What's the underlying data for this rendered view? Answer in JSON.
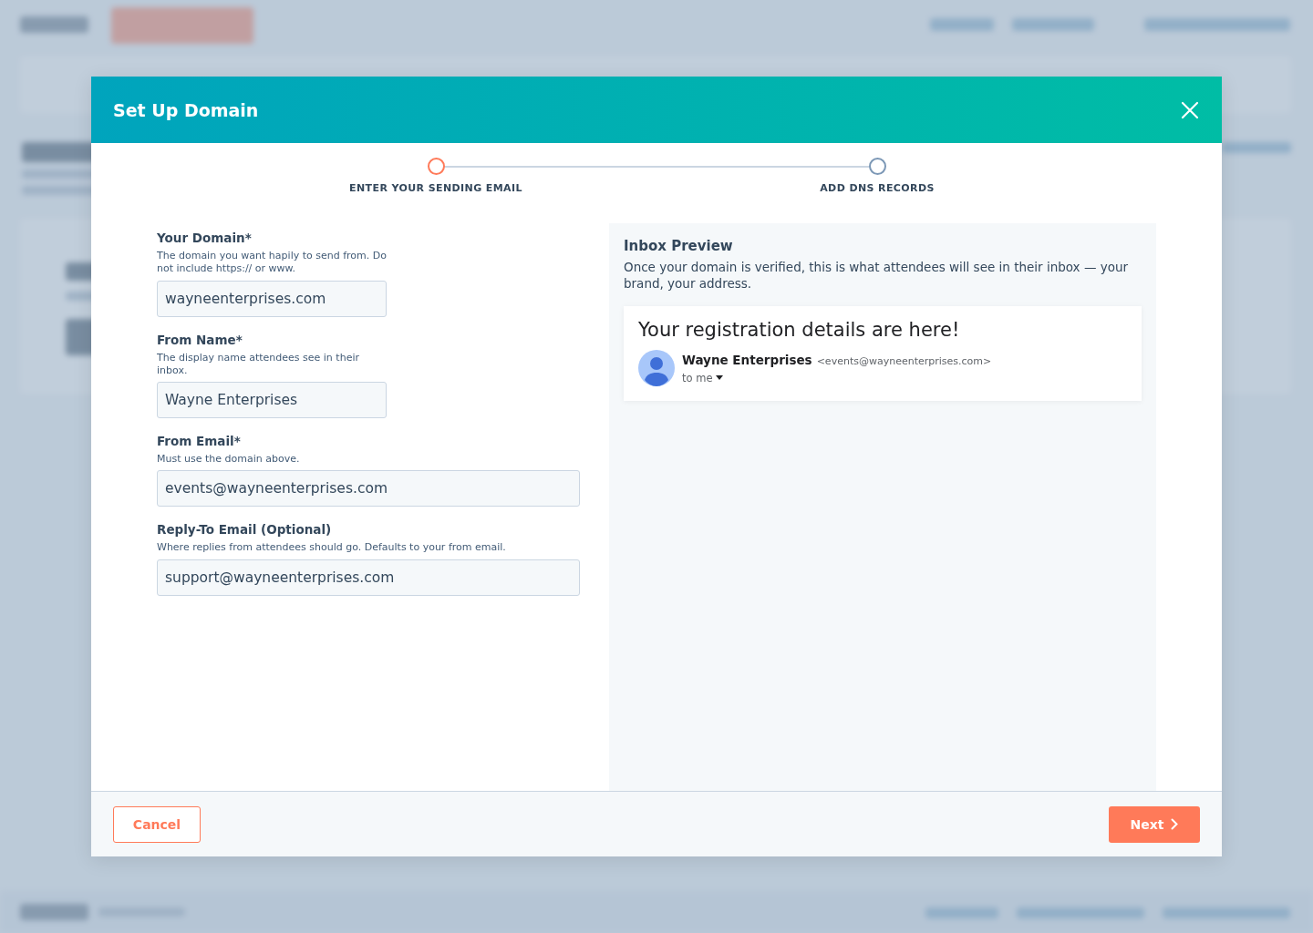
{
  "modal": {
    "title": "Set Up Domain"
  },
  "steps": [
    {
      "label": "ENTER YOUR SENDING EMAIL",
      "selected": true
    },
    {
      "label": "ADD DNS RECORDS",
      "selected": false
    }
  ],
  "fields": [
    {
      "kind": "short",
      "label": "Your Domain*",
      "hint": "The domain you want hapily to send from. Do not include https:// or www.",
      "value": "wayneenterprises.com"
    },
    {
      "kind": "short",
      "label": "From Name*",
      "hint": "The display name attendees see in their inbox.",
      "value": "Wayne Enterprises"
    },
    {
      "kind": "long",
      "label": "From Email*",
      "hint": "Must use the domain above.",
      "value": "events@wayneenterprises.com"
    },
    {
      "kind": "long",
      "label": "Reply-To Email (Optional)",
      "hint": "Where replies from attendees should go. Defaults to your from email.",
      "value": "support@wayneenterprises.com"
    }
  ],
  "preview": {
    "title": "Inbox Preview",
    "description": "Once your domain is verified, this is what attendees will see in their inbox — your brand, your address.",
    "email": {
      "subject": "Your registration details are here!",
      "sender_name": "Wayne Enterprises",
      "sender_address": "<events@wayneenterprises.com>",
      "recipient": "to me"
    }
  },
  "buttons": {
    "cancel": "Cancel",
    "next": "Next"
  }
}
